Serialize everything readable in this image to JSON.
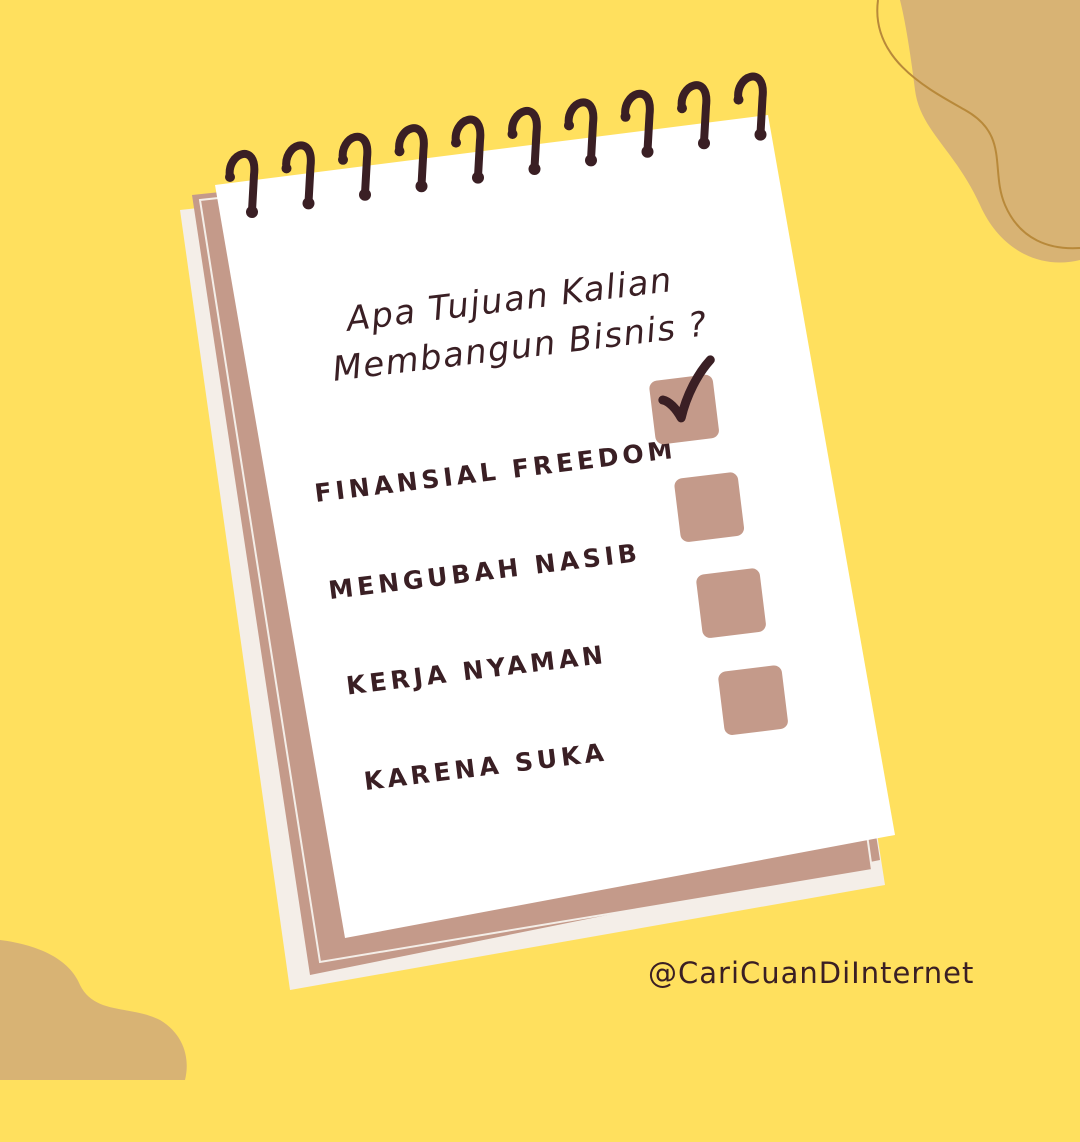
{
  "colors": {
    "background": "#FFE05E",
    "blob": "#D8B374",
    "page": "#FFFFFF",
    "backing": "#C49A8A",
    "ink": "#3A1F24"
  },
  "notepad": {
    "question": {
      "line1": "Apa Tujuan Kalian",
      "line2": "Membangun Bisnis ?"
    },
    "options": [
      {
        "label": "FINANSIAL FREEDOM",
        "checked": true
      },
      {
        "label": "MENGUBAH NASIB",
        "checked": false
      },
      {
        "label": "KERJA NYAMAN",
        "checked": false
      },
      {
        "label": "KARENA SUKA",
        "checked": false
      }
    ]
  },
  "footer": {
    "handle": "@CariCuanDiInternet"
  },
  "icons": {
    "binding": "spiral-ring-icon",
    "check": "checkmark-icon"
  }
}
